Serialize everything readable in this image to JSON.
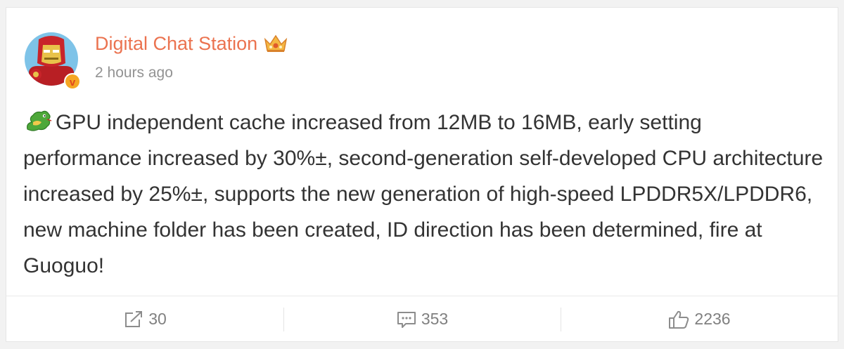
{
  "post": {
    "author": "Digital Chat Station",
    "timestamp": "2 hours ago",
    "text": "GPU independent cache increased from 12MB to 16MB, early setting performance increased by 30%±, second-generation self-developed CPU architecture increased by 25%±, supports the new generation of high-speed LPDDR5X/LPDDR6, new machine folder has been created, ID direction has been determined, fire at Guoguo!",
    "leading_icon": "dragon-emoji-icon"
  },
  "actions": {
    "repost_count": "30",
    "comment_count": "353",
    "like_count": "2236"
  },
  "colors": {
    "author": "#eb7350",
    "timestamp": "#939393",
    "text": "#333333",
    "action": "#808080"
  }
}
